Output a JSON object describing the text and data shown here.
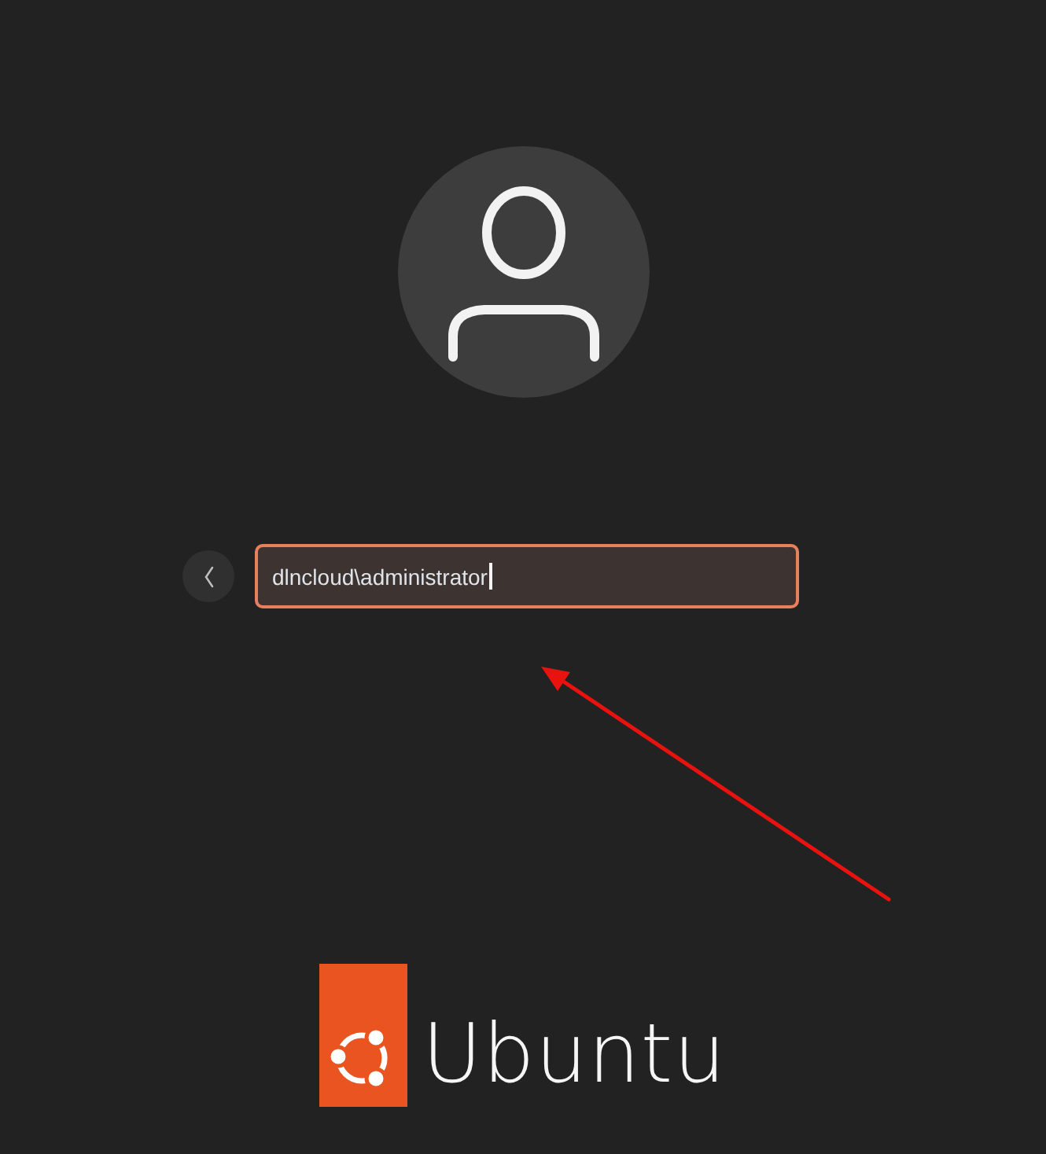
{
  "username_field": {
    "value": "dlncloud\\administrator",
    "focused": true
  },
  "brand": {
    "wordmark": "Ubuntu"
  }
}
